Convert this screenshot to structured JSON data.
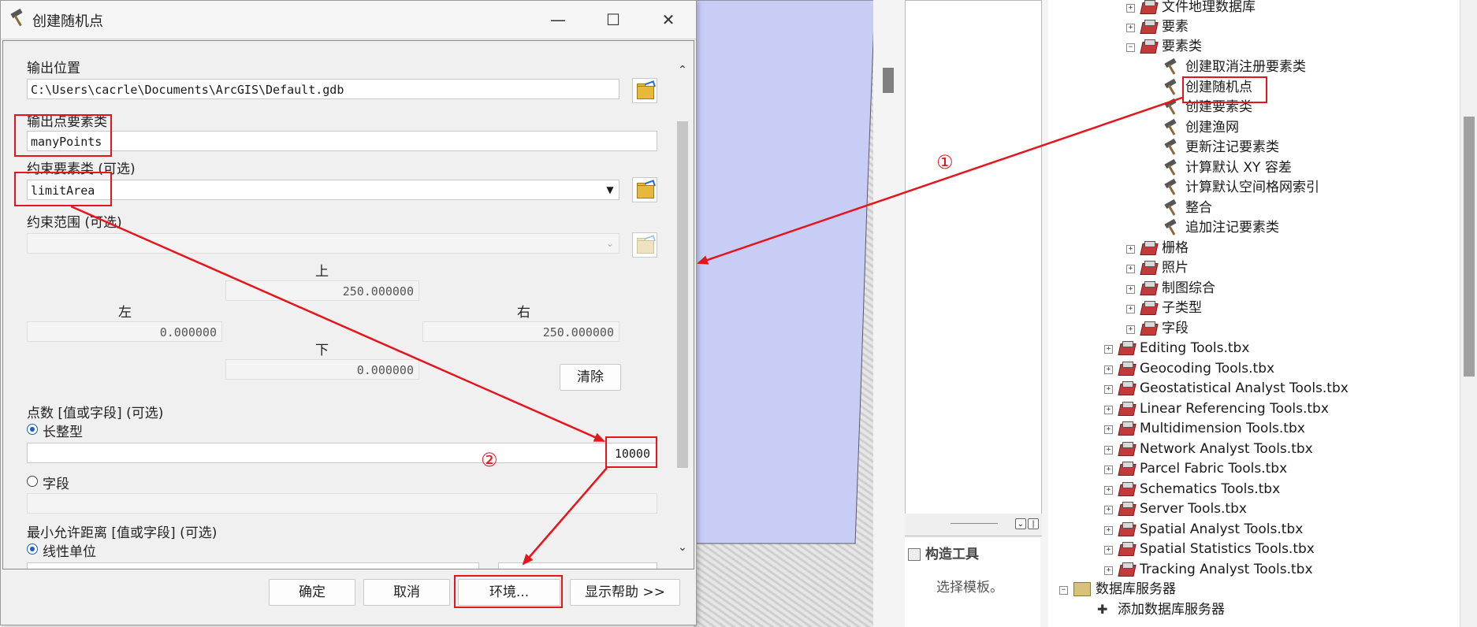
{
  "dialog": {
    "title": "创建随机点",
    "output_location": {
      "label": "输出位置",
      "value": "C:\\Users\\cacrle\\Documents\\ArcGIS\\Default.gdb"
    },
    "output_fc": {
      "label": "输出点要素类",
      "value": "manyPoints"
    },
    "constraint_fc": {
      "label": "约束要素类 (可选)",
      "value": "limitArea"
    },
    "constraint_extent": {
      "label": "约束范围 (可选)",
      "value": ""
    },
    "extent": {
      "top_label": "上",
      "top": "250.000000",
      "left_label": "左",
      "left": "0.000000",
      "right_label": "右",
      "right": "250.000000",
      "bottom_label": "下",
      "bottom": "0.000000",
      "clear_label": "清除"
    },
    "point_count": {
      "label": "点数 [值或字段] (可选)",
      "long_label": "长整型",
      "long_value": "10000",
      "field_label": "字段"
    },
    "min_distance": {
      "label": "最小允许距离 [值或字段] (可选)",
      "linear_label": "线性单位"
    },
    "buttons": {
      "ok": "确定",
      "cancel": "取消",
      "env": "环境...",
      "help": "显示帮助 >>"
    }
  },
  "annotations": {
    "one": "①",
    "two": "②"
  },
  "middle_panel": {
    "construct_title": "构造工具",
    "construct_hint": "选择模板。"
  },
  "tree": {
    "toolsets": [
      {
        "label": "文件地理数据库",
        "expanded": false
      },
      {
        "label": "要素",
        "expanded": false
      },
      {
        "label": "要素类",
        "expanded": true
      }
    ],
    "feature_class_tools": [
      "创建取消注册要素类",
      "创建随机点",
      "创建要素类",
      "创建渔网",
      "更新注记要素类",
      "计算默认 XY 容差",
      "计算默认空间格网索引",
      "整合",
      "追加注记要素类"
    ],
    "more_toolsets": [
      "栅格",
      "照片",
      "制图综合",
      "子类型",
      "字段"
    ],
    "toolboxes": [
      "Editing Tools.tbx",
      "Geocoding Tools.tbx",
      "Geostatistical Analyst Tools.tbx",
      "Linear Referencing Tools.tbx",
      "Multidimension Tools.tbx",
      "Network Analyst Tools.tbx",
      "Parcel Fabric Tools.tbx",
      "Schematics Tools.tbx",
      "Server Tools.tbx",
      "Spatial Analyst Tools.tbx",
      "Spatial Statistics Tools.tbx",
      "Tracking Analyst Tools.tbx"
    ],
    "db_servers": "数据库服务器",
    "add_db_server": "添加数据库服务器"
  },
  "colors": {
    "annotation": "#e8141b",
    "map_polygon": "#c8cdf5"
  }
}
